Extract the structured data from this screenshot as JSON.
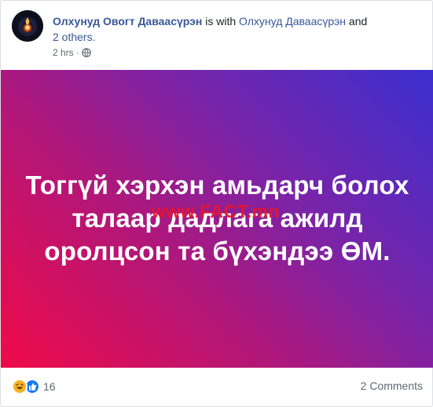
{
  "post": {
    "author": "Олхунуд Овогт Даваасүрэн",
    "with_text": " is with ",
    "tagged_user": "Олхунуд Даваасүрэн",
    "and_text": " and ",
    "others": "2 others.",
    "time": "2 hrs",
    "time_separator": "·",
    "privacy_icon": "globe-icon"
  },
  "media": {
    "caption_lines": [
      "Тоггүй хэрхэн амьдарч болох",
      "талаар дадлага ажилд",
      "оролцсон та бүхэндээ ӨМ."
    ],
    "watermark": "www.FACT.mn",
    "gradient_colors": [
      "#3a2fd0",
      "#7d23a6",
      "#b0177a",
      "#f00a48"
    ]
  },
  "footer": {
    "reaction_icons": [
      "haha-icon",
      "like-icon"
    ],
    "reaction_count": "16",
    "comments": "2 Comments"
  }
}
